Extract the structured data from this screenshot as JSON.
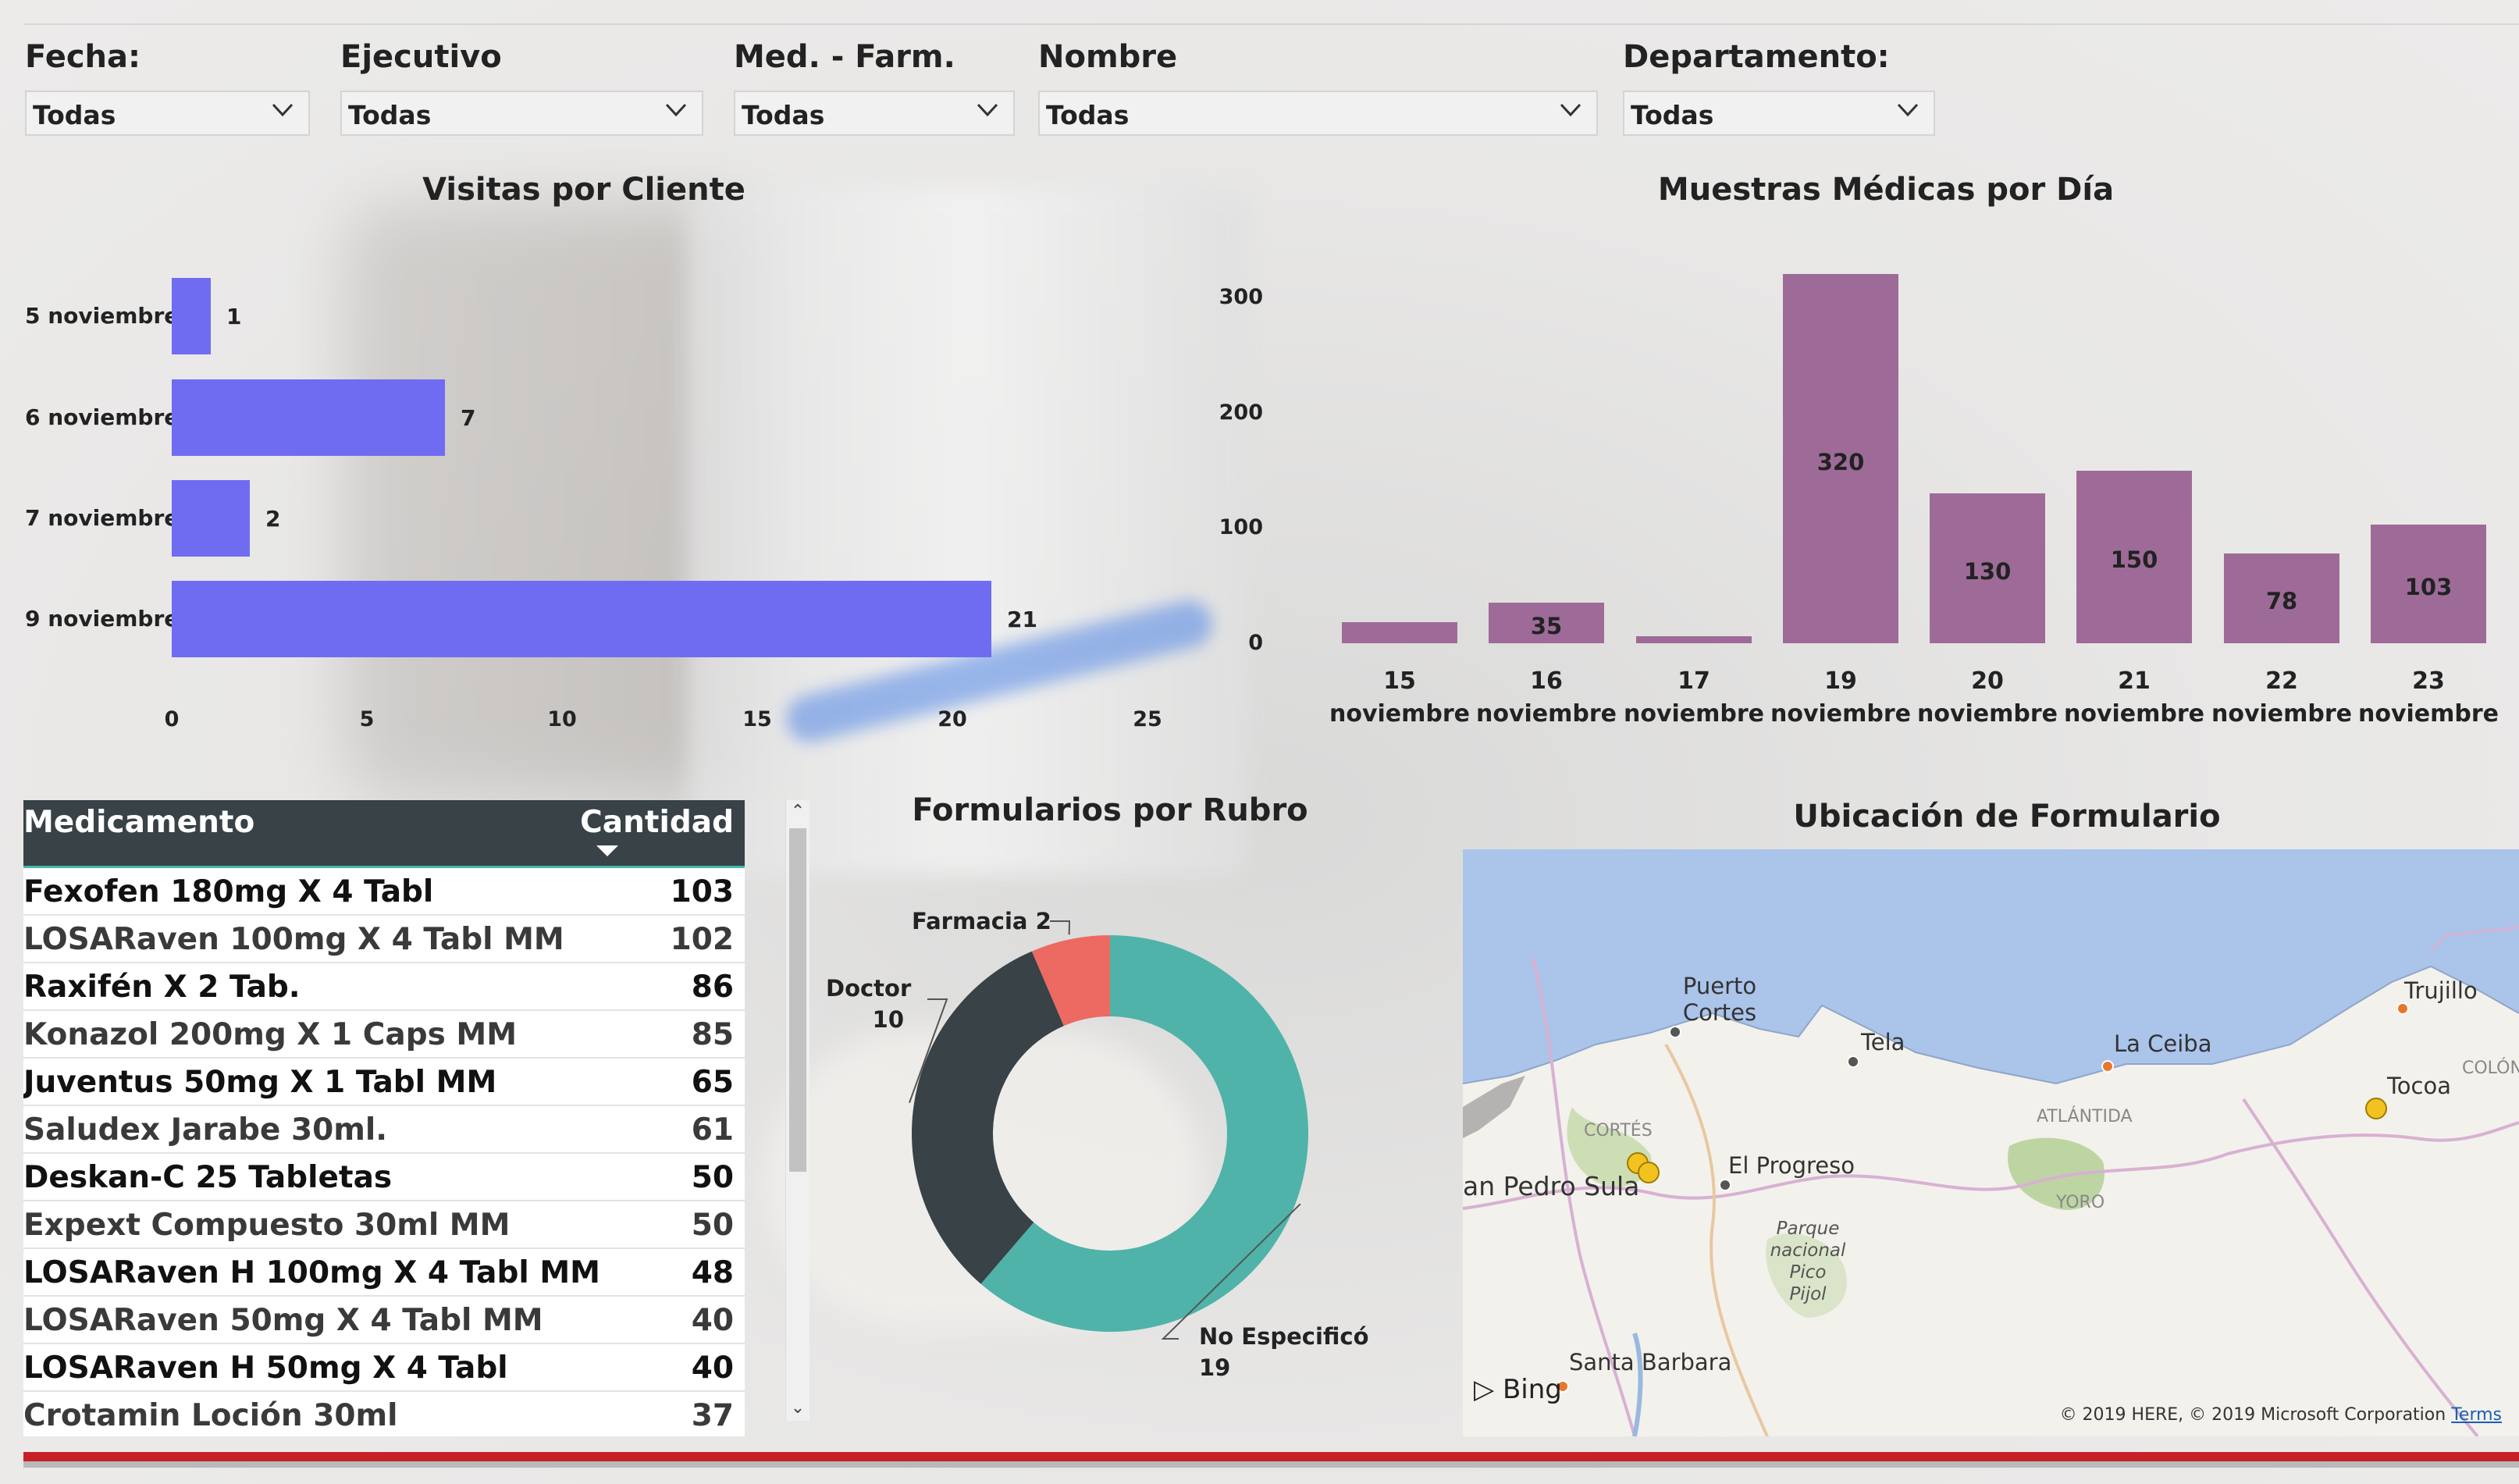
{
  "slicers": [
    {
      "label": "Fecha:",
      "value": "Todas"
    },
    {
      "label": "Ejecutivo",
      "value": "Todas"
    },
    {
      "label": "Med. - Farm.",
      "value": "Todas"
    },
    {
      "label": "Nombre",
      "value": "Todas"
    },
    {
      "label": "Departamento:",
      "value": "Todas"
    }
  ],
  "visitas": {
    "title": "Visitas por Cliente"
  },
  "muestras": {
    "title": "Muestras Médicas por Día"
  },
  "formularios": {
    "title": "Formularios por Rubro"
  },
  "ubicacion": {
    "title": "Ubicación de Formulario"
  },
  "table": {
    "headers": [
      "Medicamento",
      "Cantidad"
    ],
    "rows": [
      {
        "name": "Fexofen 180mg X 4 Tabl",
        "qty": "103"
      },
      {
        "name": "LOSARaven 100mg X 4 Tabl MM",
        "qty": "102"
      },
      {
        "name": "Raxifén X 2 Tab.",
        "qty": "86"
      },
      {
        "name": "Konazol 200mg X 1 Caps MM",
        "qty": "85"
      },
      {
        "name": "Juventus 50mg X 1 Tabl MM",
        "qty": "65"
      },
      {
        "name": "Saludex Jarabe 30ml.",
        "qty": "61"
      },
      {
        "name": "Deskan-C 25 Tabletas",
        "qty": "50"
      },
      {
        "name": "Expext Compuesto 30ml MM",
        "qty": "50"
      },
      {
        "name": "LOSARaven H 100mg X 4 Tabl MM",
        "qty": "48"
      },
      {
        "name": "LOSARaven 50mg X 4 Tabl MM",
        "qty": "40"
      },
      {
        "name": "LOSARaven H 50mg X 4 Tabl",
        "qty": "40"
      },
      {
        "name": "Crotamin Loción 30ml",
        "qty": "37"
      }
    ]
  },
  "map": {
    "places": [
      "Puerto Cortes",
      "Tela",
      "La Ceiba",
      "Trujillo",
      "Tocoa",
      "El Progreso",
      "an Pedro Sula",
      "Santa Barbara",
      "COLÓN"
    ],
    "regions": [
      "CORTÉS",
      "ATLÁNTIDA",
      "YORO"
    ],
    "park": "Parque nacional Pico Pijol",
    "bing": "Bing",
    "copyright": "© 2019 HERE, © 2019 Microsoft Corporation",
    "terms": "Terms"
  },
  "colors": {
    "bar_blue": "#6f6cf2",
    "bar_purple": "#9e6b98",
    "donut_teal": "#4fb3a9",
    "donut_dark": "#384247",
    "donut_red": "#ec6a62",
    "table_header": "#384247",
    "bottom_bar": "#c62127"
  },
  "chart_data": [
    {
      "type": "bar",
      "orientation": "horizontal",
      "title": "Visitas por Cliente",
      "categories": [
        "5 noviembre",
        "6 noviembre",
        "7 noviembre",
        "9 noviembre"
      ],
      "values": [
        1,
        7,
        2,
        21
      ],
      "xlim": [
        0,
        25
      ],
      "xticks": [
        0,
        5,
        10,
        15,
        20,
        25
      ]
    },
    {
      "type": "bar",
      "title": "Muestras Médicas por Día",
      "categories": [
        "15 noviembre",
        "16 noviembre",
        "17 noviembre",
        "19 noviembre",
        "20 noviembre",
        "21 noviembre",
        "22 noviembre",
        "23 noviembre"
      ],
      "values": [
        18,
        35,
        6,
        320,
        130,
        150,
        78,
        103
      ],
      "data_labels": [
        "",
        "35",
        "",
        "320",
        "130",
        "150",
        "78",
        "103"
      ],
      "ylim": [
        0,
        320
      ],
      "yticks": [
        0,
        100,
        200,
        300
      ]
    },
    {
      "type": "pie",
      "title": "Formularios por Rubro",
      "donut": true,
      "labels": [
        "No Especificó",
        "Doctor",
        "Farmacia"
      ],
      "values": [
        19,
        10,
        2
      ]
    }
  ]
}
